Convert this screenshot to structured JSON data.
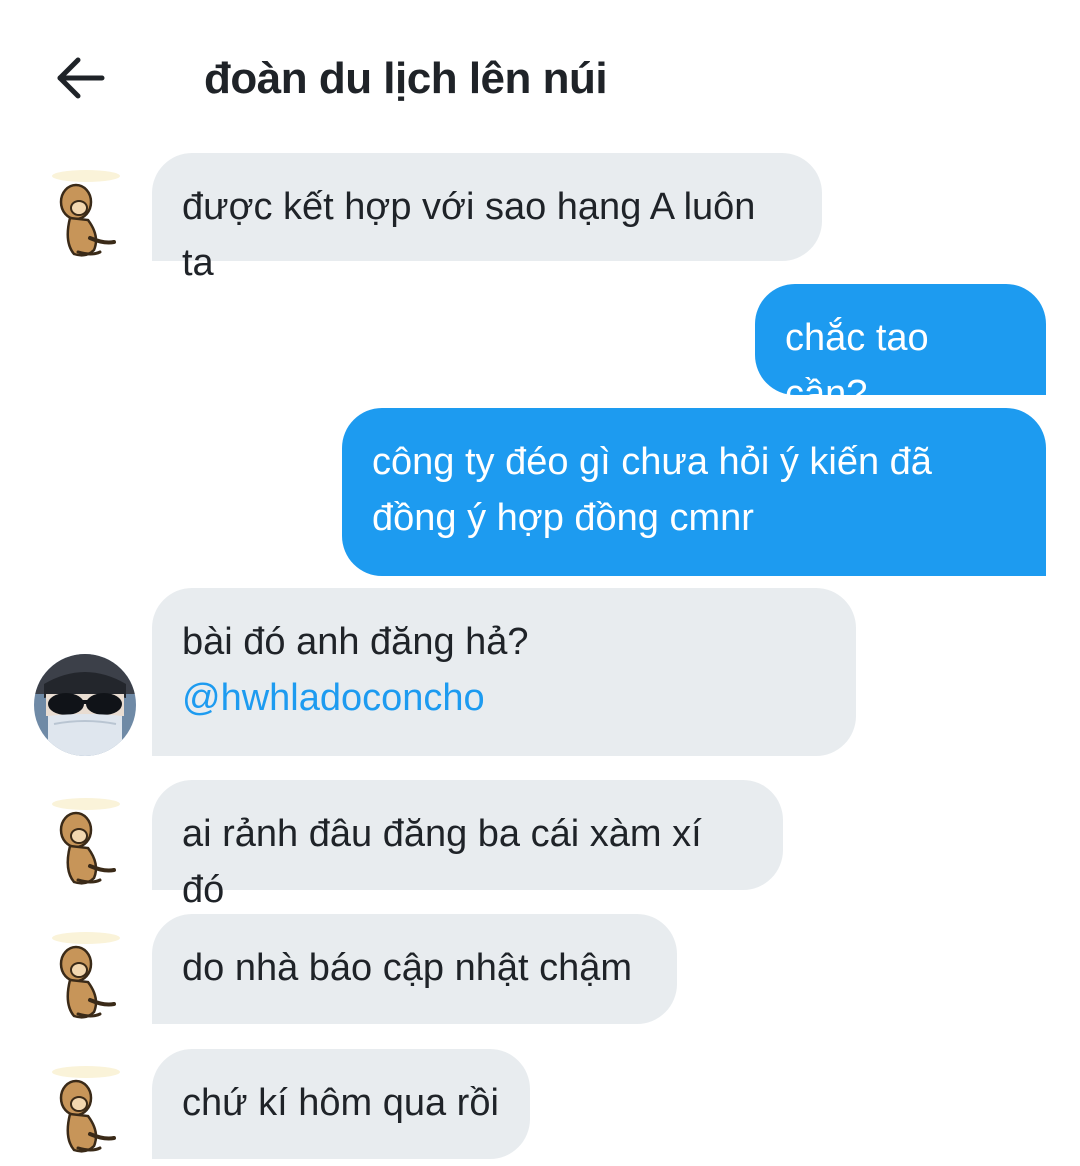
{
  "header": {
    "title": "đoàn du lịch lên núi",
    "back_icon": "arrow-left-icon"
  },
  "messages": [
    {
      "id": 1,
      "direction": "incoming",
      "avatar": "monkey-sticker",
      "lines": [
        "được kết hợp với sao hạng A luôn ta"
      ]
    },
    {
      "id": 2,
      "direction": "outgoing",
      "lines": [
        "chắc tao cần?"
      ]
    },
    {
      "id": 3,
      "direction": "outgoing",
      "lines": [
        "công ty đéo gì chưa hỏi ý kiến đã",
        "đồng ý hợp đồng cmnr"
      ]
    },
    {
      "id": 4,
      "direction": "incoming",
      "avatar": "user-photo",
      "lines": [
        "bài đó anh đăng hả?"
      ],
      "mention": "@hwhladoconcho"
    },
    {
      "id": 5,
      "direction": "incoming",
      "avatar": "monkey-sticker",
      "lines": [
        "ai rảnh đâu đăng ba cái xàm xí đó"
      ]
    },
    {
      "id": 6,
      "direction": "incoming",
      "avatar": "monkey-sticker",
      "lines": [
        "do nhà báo cập nhật chậm"
      ]
    },
    {
      "id": 7,
      "direction": "incoming",
      "avatar": "monkey-sticker",
      "lines": [
        "chứ kí hôm qua rồi"
      ]
    }
  ],
  "colors": {
    "incoming_bubble": "#e8ecef",
    "outgoing_bubble": "#1d9bf0",
    "mention": "#1d9bf0",
    "text": "#1f2328"
  }
}
